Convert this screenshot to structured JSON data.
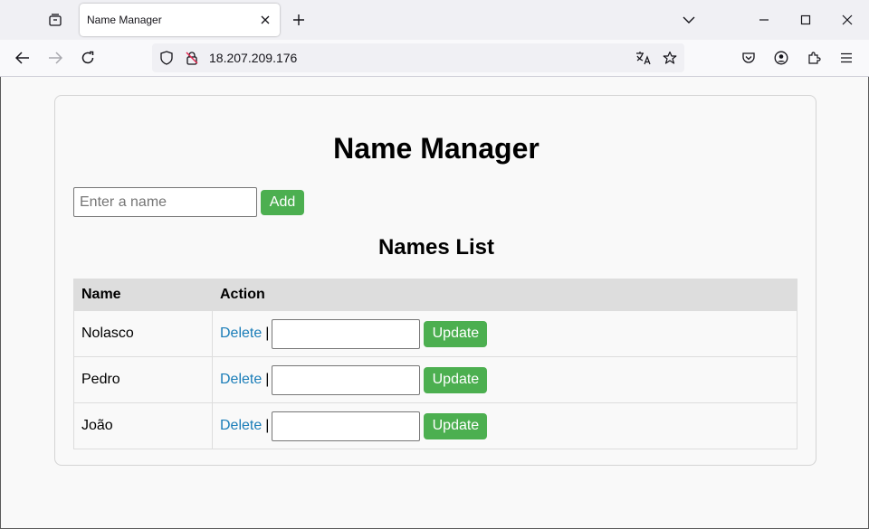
{
  "browser": {
    "tab_title": "Name Manager",
    "url": "18.207.209.176"
  },
  "page": {
    "title": "Name Manager",
    "name_input_placeholder": "Enter a name",
    "add_label": "Add",
    "list_title": "Names List",
    "table": {
      "headers": [
        "Name",
        "Action"
      ],
      "rows": [
        {
          "name": "Nolasco",
          "delete_label": "Delete",
          "separator": "|",
          "update_label": "Update"
        },
        {
          "name": "Pedro",
          "delete_label": "Delete",
          "separator": "|",
          "update_label": "Update"
        },
        {
          "name": "João",
          "delete_label": "Delete",
          "separator": "|",
          "update_label": "Update"
        }
      ]
    }
  },
  "colors": {
    "accent_green": "#4caf50",
    "link_blue": "#1a7db8",
    "header_gray": "#dddddd"
  }
}
